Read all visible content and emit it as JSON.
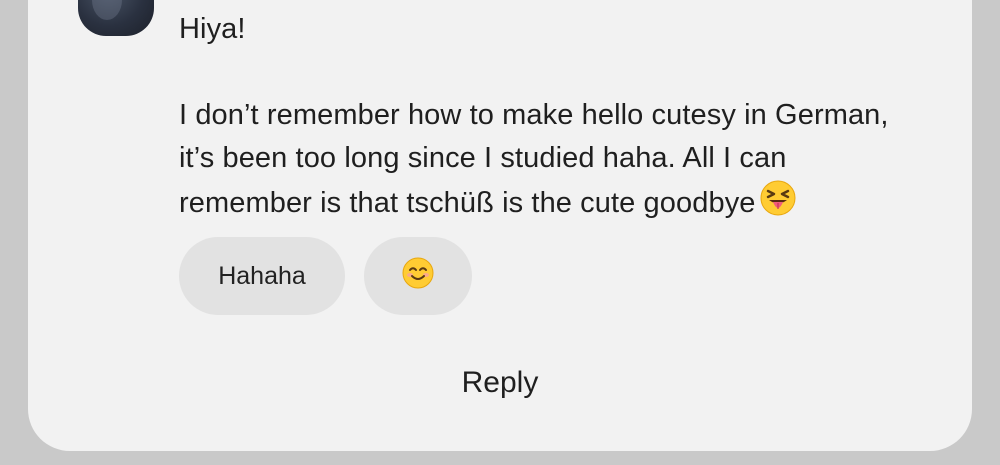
{
  "message": {
    "greeting": "Hiya!",
    "line1": "I don’t remember how to make hello cutesy in German,",
    "line2": "it’s been too long since I studied haha.  All I can",
    "line3": "remember is that tschüß is the cute goodbye",
    "trailing_emoji": "squinting-face-with-tongue"
  },
  "quick_replies": [
    {
      "label": "Hahaha"
    },
    {
      "emoji": "smiling-face-with-smiling-eyes"
    }
  ],
  "reply_label": "Reply",
  "colors": {
    "background": "#c9c9c9",
    "card": "#f2f2f2",
    "chip": "#e2e2e2",
    "text": "#1f1f1f"
  }
}
